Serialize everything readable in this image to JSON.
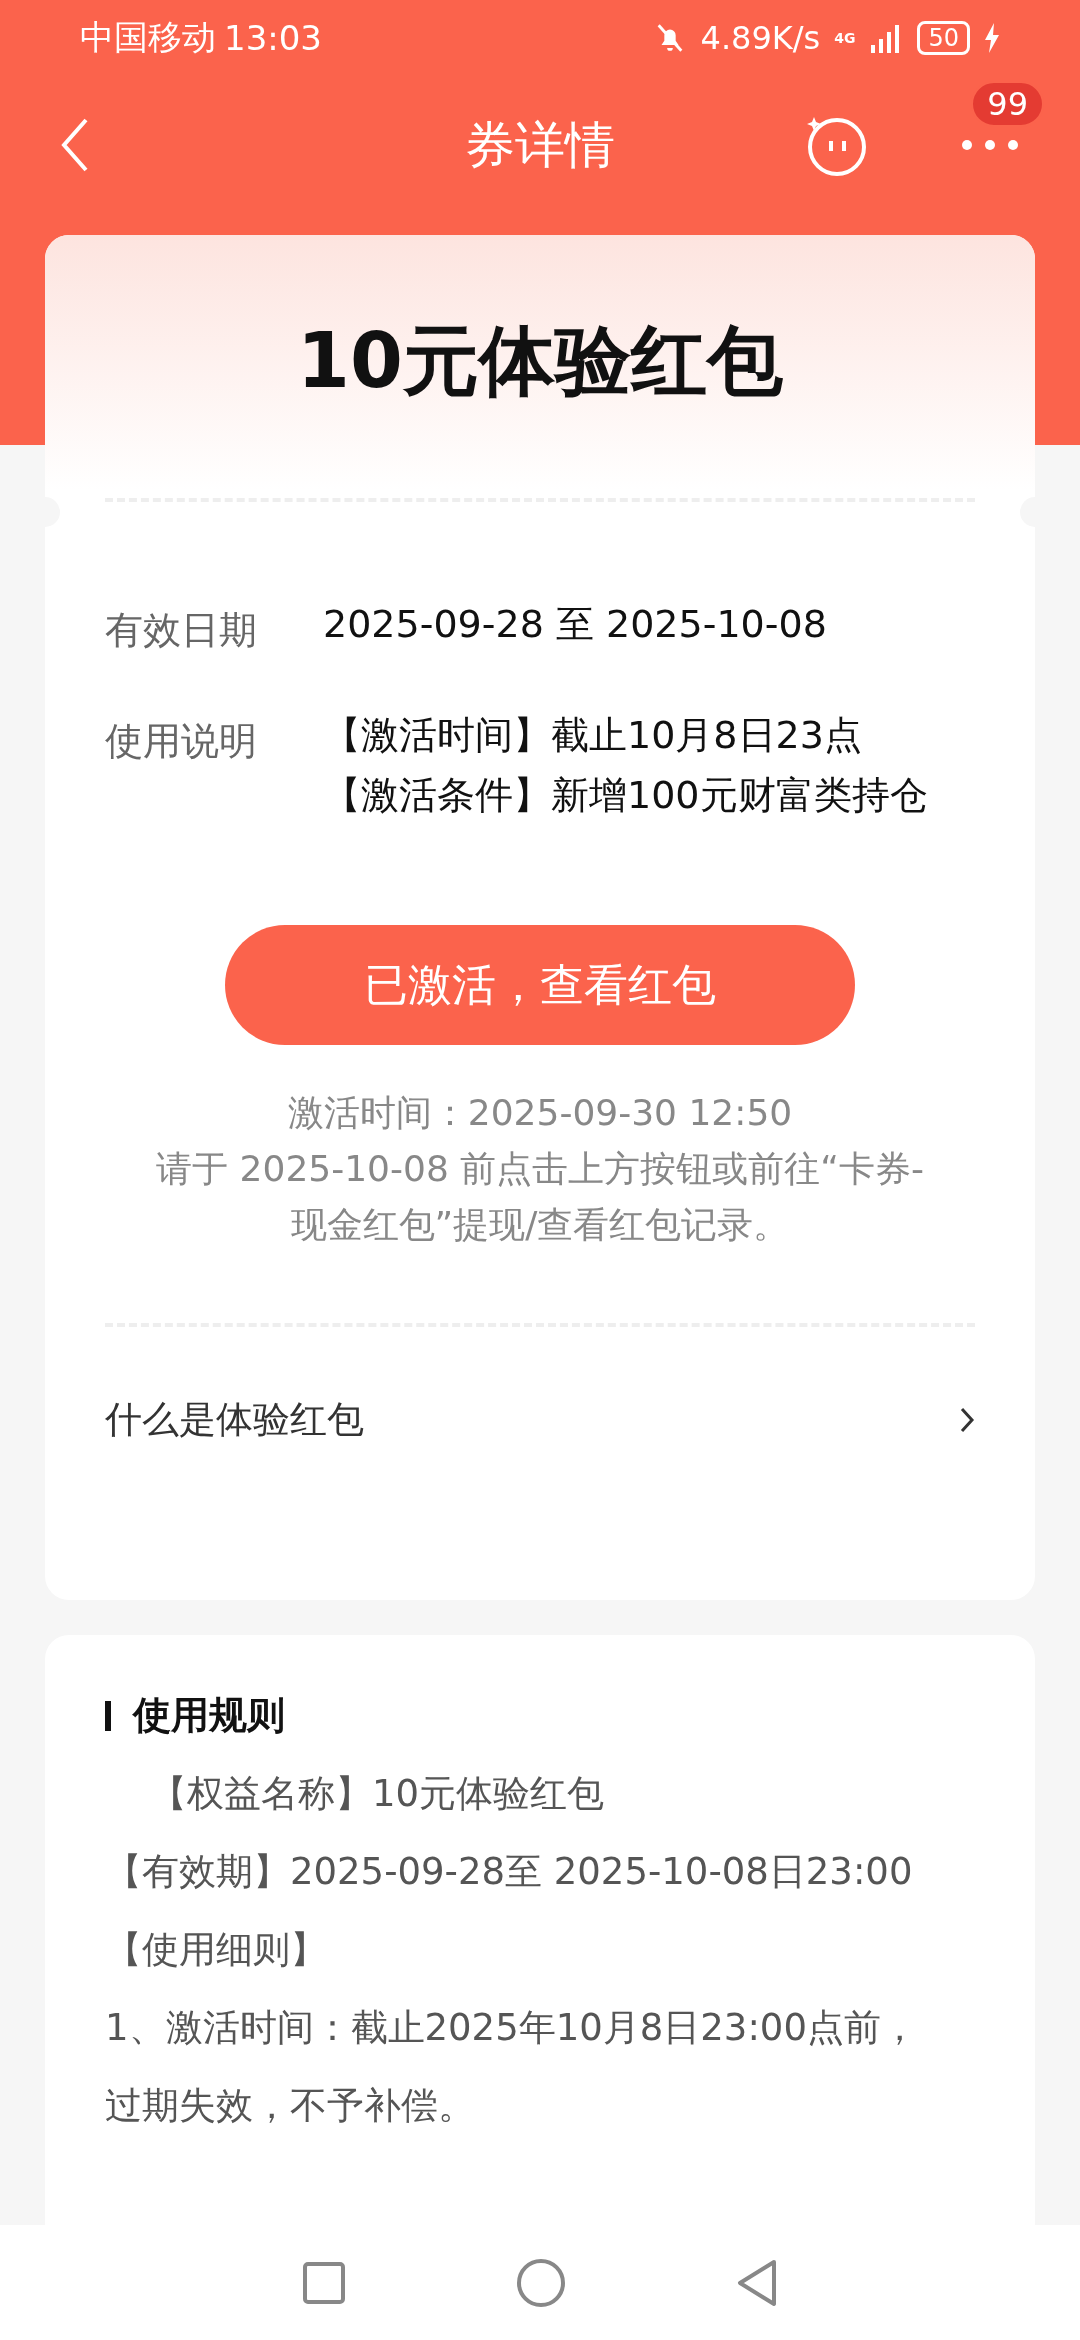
{
  "status_bar": {
    "carrier": "中国移动",
    "time": "13:03",
    "speed": "4.89K/s",
    "network": "4G",
    "battery": "50"
  },
  "header": {
    "title": "券详情",
    "badge": "99"
  },
  "coupon": {
    "title": "10元体验红包",
    "fields": [
      {
        "label": "有效日期",
        "lines": [
          "2025-09-28 至 2025-10-08"
        ]
      },
      {
        "label": "使用说明",
        "lines": [
          "【激活时间】截止10月8日23点",
          "【激活条件】新增100元财富类持仓"
        ]
      }
    ],
    "button": "已激活，查看红包",
    "activated_at": "激活时间：2025-09-30 12:50",
    "note": "请于 2025-10-08 前点击上方按钮或前往“卡券-现金红包”提现/查看红包记录。",
    "link": "什么是体验红包"
  },
  "rules": {
    "title": "使用规则",
    "lines": [
      "【权益名称】10元体验红包",
      "【有效期】2025-09-28至 2025-10-08日23:00",
      "【使用细则】",
      "1、激活时间：截止2025年10月8日23:00点前，过期失效，不予补偿。"
    ]
  }
}
